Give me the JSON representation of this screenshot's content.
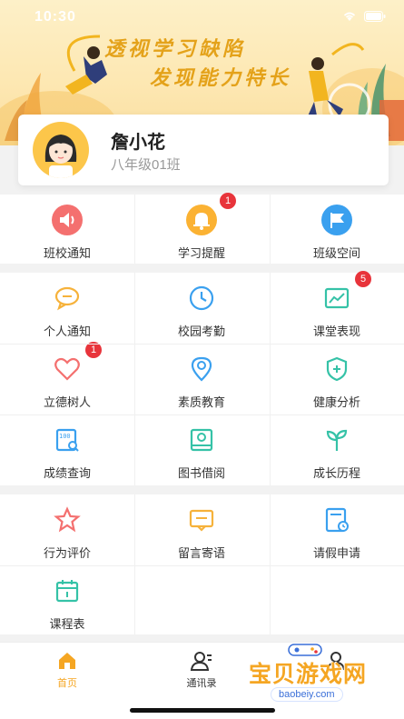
{
  "status_bar": {
    "time": "10:30"
  },
  "banner": {
    "slogan_line1": "透视学习缺陷",
    "slogan_line2": "发现能力特长"
  },
  "profile": {
    "name": "詹小花",
    "class": "八年级01班"
  },
  "sections": [
    {
      "items": [
        {
          "label": "班校通知",
          "icon": "speaker-icon",
          "color": "#f4706f",
          "badge": ""
        },
        {
          "label": "学习提醒",
          "icon": "bell-icon",
          "color": "#fbb233",
          "badge": "1"
        },
        {
          "label": "班级空间",
          "icon": "flag-icon",
          "color": "#3aa0ef",
          "badge": ""
        }
      ]
    },
    {
      "items": [
        {
          "label": "个人通知",
          "icon": "chat-bubble-icon",
          "color": "#f6b23b",
          "badge": ""
        },
        {
          "label": "校园考勤",
          "icon": "clock-icon",
          "color": "#3aa0ef",
          "badge": ""
        },
        {
          "label": "课堂表现",
          "icon": "trend-chart-icon",
          "color": "#35c2a7",
          "badge": "5"
        },
        {
          "label": "立德树人",
          "icon": "heart-icon",
          "color": "#f4706f",
          "badge": "1"
        },
        {
          "label": "素质教育",
          "icon": "location-pin-icon",
          "color": "#3aa0ef",
          "badge": ""
        },
        {
          "label": "健康分析",
          "icon": "health-shield-icon",
          "color": "#35c2a7",
          "badge": ""
        },
        {
          "label": "成绩查询",
          "icon": "score-search-icon",
          "color": "#3aa0ef",
          "badge": ""
        },
        {
          "label": "图书借阅",
          "icon": "book-icon",
          "color": "#35c2a7",
          "badge": ""
        },
        {
          "label": "成长历程",
          "icon": "sprout-icon",
          "color": "#35c2a7",
          "badge": ""
        }
      ]
    },
    {
      "items": [
        {
          "label": "行为评价",
          "icon": "star-icon",
          "color": "#f4706f",
          "badge": ""
        },
        {
          "label": "留言寄语",
          "icon": "message-icon",
          "color": "#f6b23b",
          "badge": ""
        },
        {
          "label": "请假申请",
          "icon": "leave-form-icon",
          "color": "#3aa0ef",
          "badge": ""
        },
        {
          "label": "课程表",
          "icon": "calendar-icon",
          "color": "#35c2a7",
          "badge": ""
        }
      ]
    }
  ],
  "tabbar": {
    "tabs": [
      {
        "label": "首页",
        "icon": "home-icon",
        "active": true
      },
      {
        "label": "通讯录",
        "icon": "contacts-icon",
        "active": false
      },
      {
        "label": "",
        "icon": "profile-icon",
        "active": false
      }
    ],
    "active_color": "#f5a623",
    "inactive_color": "#333333"
  },
  "watermark": {
    "text": "宝贝游戏网",
    "url": "baobeiy.com"
  }
}
